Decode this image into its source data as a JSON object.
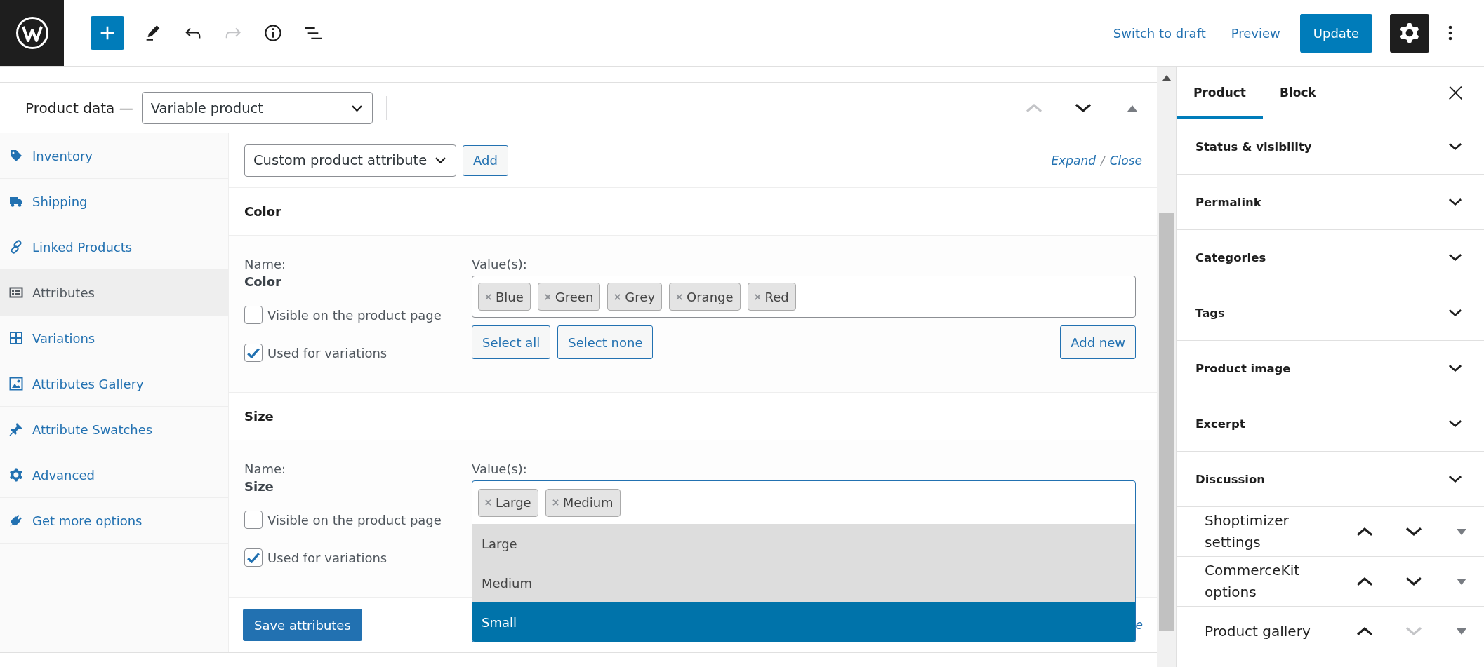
{
  "top_bar": {
    "tools": [
      {
        "kind": "add",
        "disabled": false
      },
      {
        "kind": "edit",
        "disabled": false
      },
      {
        "kind": "undo",
        "disabled": false
      },
      {
        "kind": "redo",
        "disabled": true
      },
      {
        "kind": "details",
        "disabled": false
      },
      {
        "kind": "outline",
        "disabled": false
      }
    ],
    "links": [
      "Switch to draft",
      "Preview"
    ],
    "update_button": "Update",
    "settings": {
      "pressed": true
    }
  },
  "product_data": {
    "title": "Product data —",
    "type_select": {
      "value": "Variable product"
    },
    "expanded": true,
    "controls": [
      {
        "kind": "up",
        "disabled": true
      },
      {
        "kind": "down",
        "disabled": false
      }
    ],
    "tabs": [
      {
        "kind": "inventory",
        "label": "Inventory",
        "selected": false
      },
      {
        "kind": "shipping",
        "label": "Shipping",
        "selected": false
      },
      {
        "kind": "linked",
        "label": "Linked Products",
        "selected": false
      },
      {
        "kind": "attributes",
        "label": "Attributes",
        "selected": true
      },
      {
        "kind": "variations",
        "label": "Variations",
        "selected": false
      },
      {
        "kind": "gallery",
        "label": "Attributes Gallery",
        "selected": false
      },
      {
        "kind": "swatches",
        "label": "Attribute Swatches",
        "selected": false
      },
      {
        "kind": "advanced",
        "label": "Advanced",
        "selected": false
      },
      {
        "kind": "plugins",
        "label": "Get more options",
        "selected": false
      }
    ],
    "toolbar": {
      "attribute_select": {
        "value": "Custom product attribute"
      },
      "add_button": "Add",
      "expand_link": "Expand",
      "separator": "/",
      "close_link": "Close"
    },
    "attributes": [
      {
        "title": "Color",
        "name_label": "Name:",
        "name": "Color",
        "options": [
          {
            "label": "Visible on the product page",
            "checked": false
          },
          {
            "label": "Used for variations",
            "checked": true
          }
        ],
        "values_label": "Value(s):",
        "values": [
          "Blue",
          "Green",
          "Grey",
          "Orange",
          "Red"
        ],
        "focused": false,
        "buttons": [
          "Select all",
          "Select none"
        ],
        "add_new": "Add new"
      },
      {
        "title": "Size",
        "name_label": "Name:",
        "name": "Size",
        "options": [
          {
            "label": "Visible on the product page",
            "checked": false
          },
          {
            "label": "Used for variations",
            "checked": true
          }
        ],
        "values_label": "Value(s):",
        "values": [
          "Large",
          "Medium"
        ],
        "focused": true,
        "dropdown": [
          {
            "label": "Large",
            "chosen": true,
            "selected": false
          },
          {
            "label": "Medium",
            "chosen": true,
            "selected": false
          },
          {
            "label": "Small",
            "chosen": false,
            "selected": true
          }
        ]
      }
    ],
    "footer": {
      "save_button": "Save attributes",
      "hidden_link_fragment": "e"
    }
  },
  "sidebar": {
    "tabs": [
      {
        "label": "Product",
        "selected": true
      },
      {
        "label": "Block",
        "selected": false
      }
    ],
    "panels": [
      {
        "title": "Status & visibility",
        "expanded": false
      },
      {
        "title": "Permalink",
        "expanded": false
      },
      {
        "title": "Categories",
        "expanded": false
      },
      {
        "title": "Tags",
        "expanded": false
      },
      {
        "title": "Product image",
        "expanded": false
      },
      {
        "title": "Excerpt",
        "expanded": false
      },
      {
        "title": "Discussion",
        "expanded": false
      }
    ],
    "meta_boxes": [
      {
        "title": "Shoptimizer settings",
        "expanded": false,
        "controls": [
          {
            "kind": "up",
            "disabled": false
          },
          {
            "kind": "down",
            "disabled": false
          }
        ]
      },
      {
        "title": "CommerceKit options",
        "expanded": false,
        "controls": [
          {
            "kind": "up",
            "disabled": false
          },
          {
            "kind": "down",
            "disabled": false
          }
        ]
      },
      {
        "title": "Product gallery",
        "expanded": false,
        "controls": [
          {
            "kind": "up",
            "disabled": false
          },
          {
            "kind": "down",
            "disabled": true
          }
        ]
      }
    ]
  }
}
